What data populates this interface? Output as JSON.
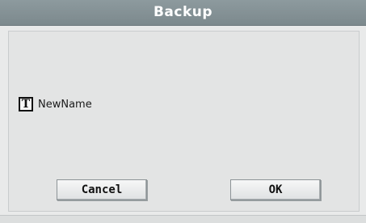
{
  "dialog": {
    "title": "Backup"
  },
  "name_field": {
    "icon": "text-edit-icon",
    "icon_glyph": "T",
    "value": "NewName"
  },
  "buttons": {
    "cancel_label": "Cancel",
    "ok_label": "OK"
  }
}
